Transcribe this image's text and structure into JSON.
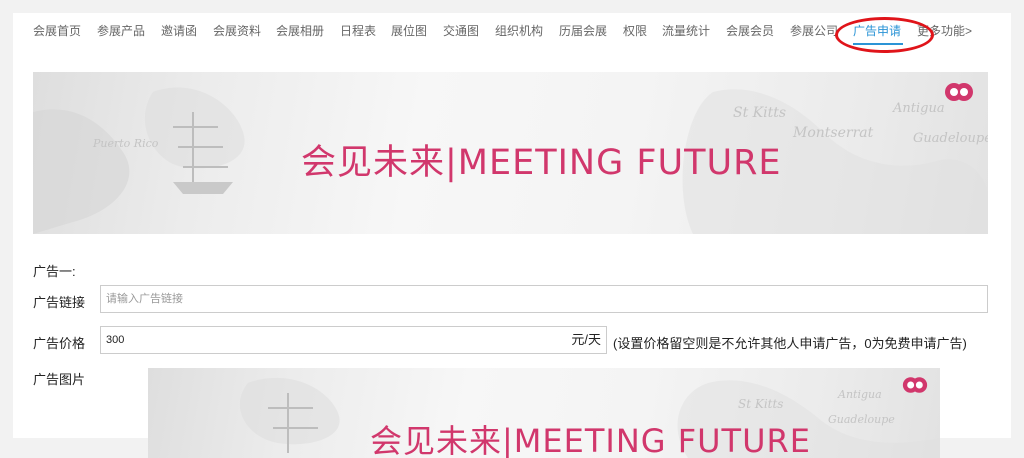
{
  "nav": {
    "items": [
      {
        "label": "会展首页"
      },
      {
        "label": "参展产品"
      },
      {
        "label": "邀请函"
      },
      {
        "label": "会展资料"
      },
      {
        "label": "会展相册"
      },
      {
        "label": "日程表"
      },
      {
        "label": "展位图"
      },
      {
        "label": "交通图"
      },
      {
        "label": "组织机构"
      },
      {
        "label": "历届会展"
      },
      {
        "label": "权限"
      },
      {
        "label": "流量统计"
      },
      {
        "label": "会展会员"
      },
      {
        "label": "参展公司"
      },
      {
        "label": "广告申请",
        "active": true
      },
      {
        "label": "更多功能>"
      }
    ],
    "active_color": "#2b94d6",
    "highlight_color": "#e0141a"
  },
  "banner": {
    "text": "会见未来|MEETING FUTURE",
    "text_color": "#d1376c",
    "logo_icon": "double-circle-logo"
  },
  "form": {
    "section_title": "广告一:",
    "link_label": "广告链接",
    "link_placeholder": "请输入广告链接",
    "price_label": "广告价格",
    "price_value": "300",
    "price_unit": "元/天",
    "price_hint": "(设置价格留空则是不允许其他人申请广告，0为免费申请广告)",
    "image_label": "广告图片"
  }
}
